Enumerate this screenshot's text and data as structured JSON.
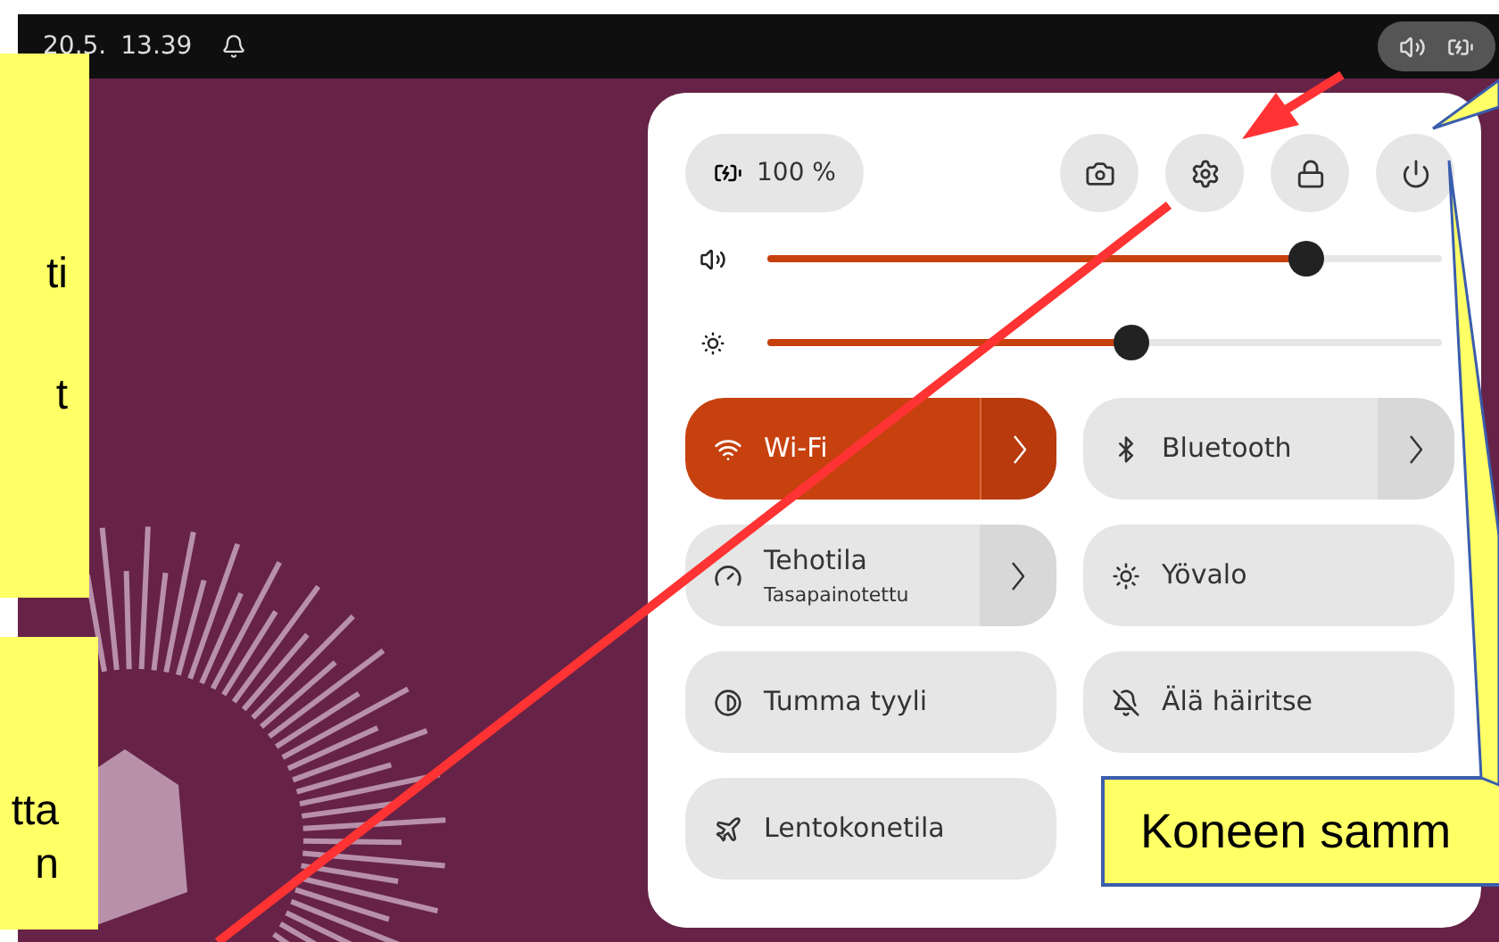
{
  "top_bar": {
    "date": "20.5.",
    "time": "13.39"
  },
  "panel": {
    "battery": "100 %",
    "buttons": [
      {
        "kind": "screenshot"
      },
      {
        "kind": "settings"
      },
      {
        "kind": "lock"
      },
      {
        "kind": "power"
      }
    ],
    "sliders": [
      {
        "kind": "volume",
        "level": 0.8
      },
      {
        "kind": "brightness",
        "level": 0.54
      }
    ],
    "tiles": [
      {
        "kind": "wifi",
        "label": "Wi-Fi",
        "on": true,
        "expandable": true
      },
      {
        "kind": "bluetooth",
        "label": "Bluetooth",
        "on": false,
        "expandable": true
      },
      {
        "kind": "power-mode",
        "label": "Tehotila",
        "subtitle": "Tasapainotettu",
        "on": false,
        "expandable": true
      },
      {
        "kind": "night-light",
        "label": "Yövalo",
        "on": false,
        "expandable": false
      },
      {
        "kind": "dark-style",
        "label": "Tumma tyyli",
        "on": false,
        "expandable": false
      },
      {
        "kind": "do-not-disturb",
        "label": "Älä häiritse",
        "on": false,
        "expandable": false
      },
      {
        "kind": "airplane",
        "label": "Lentokonetila",
        "on": false,
        "expandable": false
      }
    ]
  },
  "callouts": [
    {
      "lines": [
        "ti",
        "t"
      ]
    },
    {
      "lines": [
        "tta",
        "n"
      ]
    },
    {
      "lines": [
        "Koneen samm"
      ]
    }
  ]
}
